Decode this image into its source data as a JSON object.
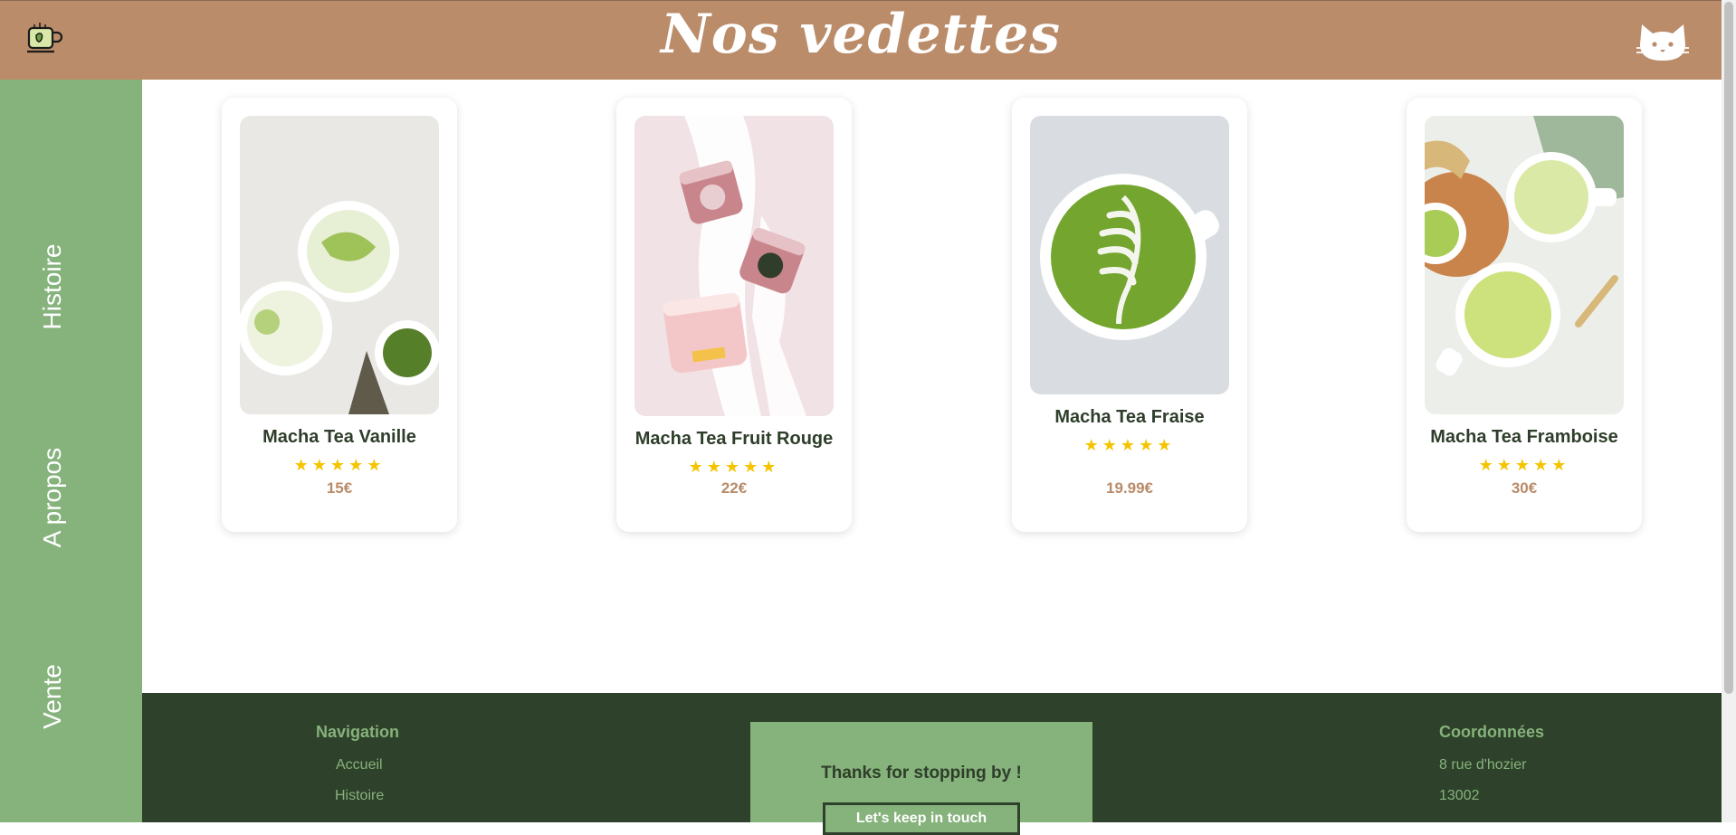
{
  "header": {
    "title": "Nos vedettes",
    "logo_icon": "teacup-icon",
    "account_icon": "cat-icon"
  },
  "sidebar": {
    "items": [
      {
        "label": "Histoire"
      },
      {
        "label": "A propos"
      },
      {
        "label": "Vente"
      }
    ]
  },
  "products": [
    {
      "name": "Macha Tea Vanille",
      "stars": "★★★★★",
      "rating": 5,
      "price": "15€"
    },
    {
      "name": "Macha Tea Fruit Rouge",
      "stars": "★★★★★",
      "rating": 5,
      "price": "22€"
    },
    {
      "name": "Macha Tea Fraise",
      "stars": "★★★★★",
      "rating": 5,
      "price": "19.99€"
    },
    {
      "name": "Macha Tea Framboise",
      "stars": "★★★★★",
      "rating": 5,
      "price": "30€"
    }
  ],
  "footer": {
    "navigation": {
      "heading": "Navigation",
      "links": [
        "Accueil",
        "Histoire"
      ]
    },
    "contact_box": {
      "text": "Thanks for stopping by !",
      "button_label": "Let's keep in touch"
    },
    "coordinates": {
      "heading": "Coordonnées",
      "lines": [
        "8 rue d'hozier",
        "13002"
      ]
    }
  },
  "colors": {
    "header": "#ba8c6a",
    "sidebar": "#86b27c",
    "footer": "#2e412a",
    "star": "#f5c400",
    "price": "#b98a67"
  }
}
